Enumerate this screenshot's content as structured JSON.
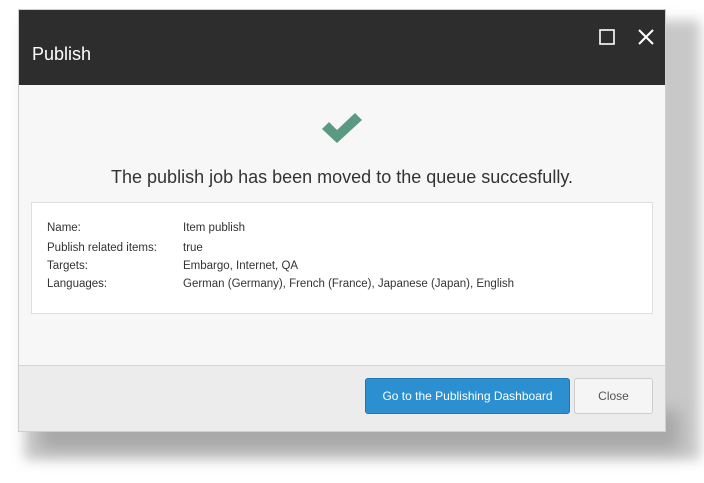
{
  "dialog": {
    "title": "Publish",
    "message": "The publish job has been moved to the queue succesfully.",
    "details": [
      {
        "label": "Name:",
        "value": "Item publish"
      },
      {
        "label": "Publish related items:",
        "value": "true"
      },
      {
        "label": "Targets:",
        "value": "Embargo, Internet, QA"
      },
      {
        "label": "Languages:",
        "value": "German (Germany), French (France), Japanese (Japan), English"
      }
    ],
    "buttons": {
      "dashboard_label": "Go to the Publishing Dashboard",
      "close_label": "Close"
    }
  },
  "colors": {
    "titlebar": "#2d2d2d",
    "check": "#5a9a82",
    "primary": "#2b8fd0"
  },
  "icons": {
    "success": "checkmark-icon",
    "maximize": "maximize-icon",
    "close": "close-icon"
  }
}
